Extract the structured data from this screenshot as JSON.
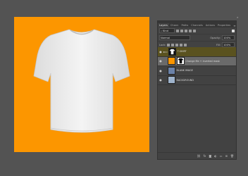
{
  "colors": {
    "canvas": "#fc9600",
    "workspace": "#535353",
    "panel": "#424242"
  },
  "panel": {
    "tabs": [
      "Layers",
      "Chann",
      "Paths",
      "Channels",
      "Actions",
      "Properties"
    ],
    "filter_label": "Kind",
    "blend_mode": "Normal",
    "opacity_label": "Opacity:",
    "opacity_value": "100%",
    "lock_label": "Lock:",
    "fill_label": "Fill:",
    "fill_value": "100%"
  },
  "layers": [
    {
      "name": "T-SHIRT",
      "type": "group"
    },
    {
      "name": "Change Me + inverted mask",
      "type": "smart-object",
      "selected": true
    },
    {
      "name": "BLANK IMAGE",
      "type": "layer"
    },
    {
      "name": "BACKGROUND",
      "type": "layer"
    }
  ],
  "footer_icons": [
    "link-icon",
    "fx-icon",
    "mask-icon",
    "adjustment-icon",
    "folder-icon",
    "new-layer-icon",
    "trash-icon"
  ]
}
